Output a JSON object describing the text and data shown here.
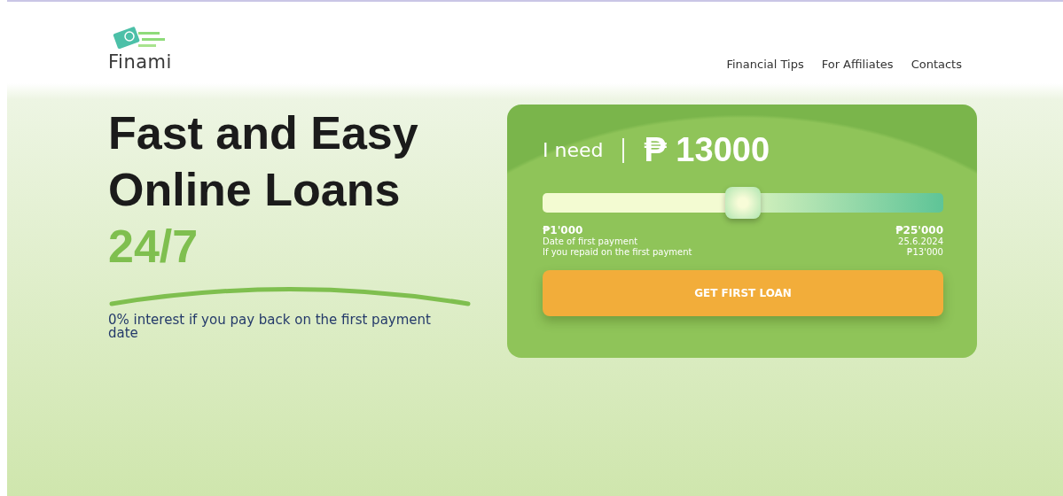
{
  "header": {
    "logo": "Finami",
    "nav": [
      "Financial Tips",
      "For Affiliates",
      "Contacts"
    ]
  },
  "hero": {
    "title_lines": [
      "Fast and Easy",
      "Online Loans"
    ],
    "accent": "24/7",
    "note": "0% interest if you pay back on the first payment date"
  },
  "calculator": {
    "label": "I need",
    "amount": "₱ 13000",
    "slider": {
      "level": 0.5
    },
    "min": "₱1'000",
    "max": "₱25'000",
    "rows": [
      {
        "label": "Date of first payment",
        "value": "25.6.2024"
      },
      {
        "label": "If you repaid on the first payment",
        "value": "₱13'000"
      }
    ],
    "button": "GET FIRST LOAN"
  }
}
